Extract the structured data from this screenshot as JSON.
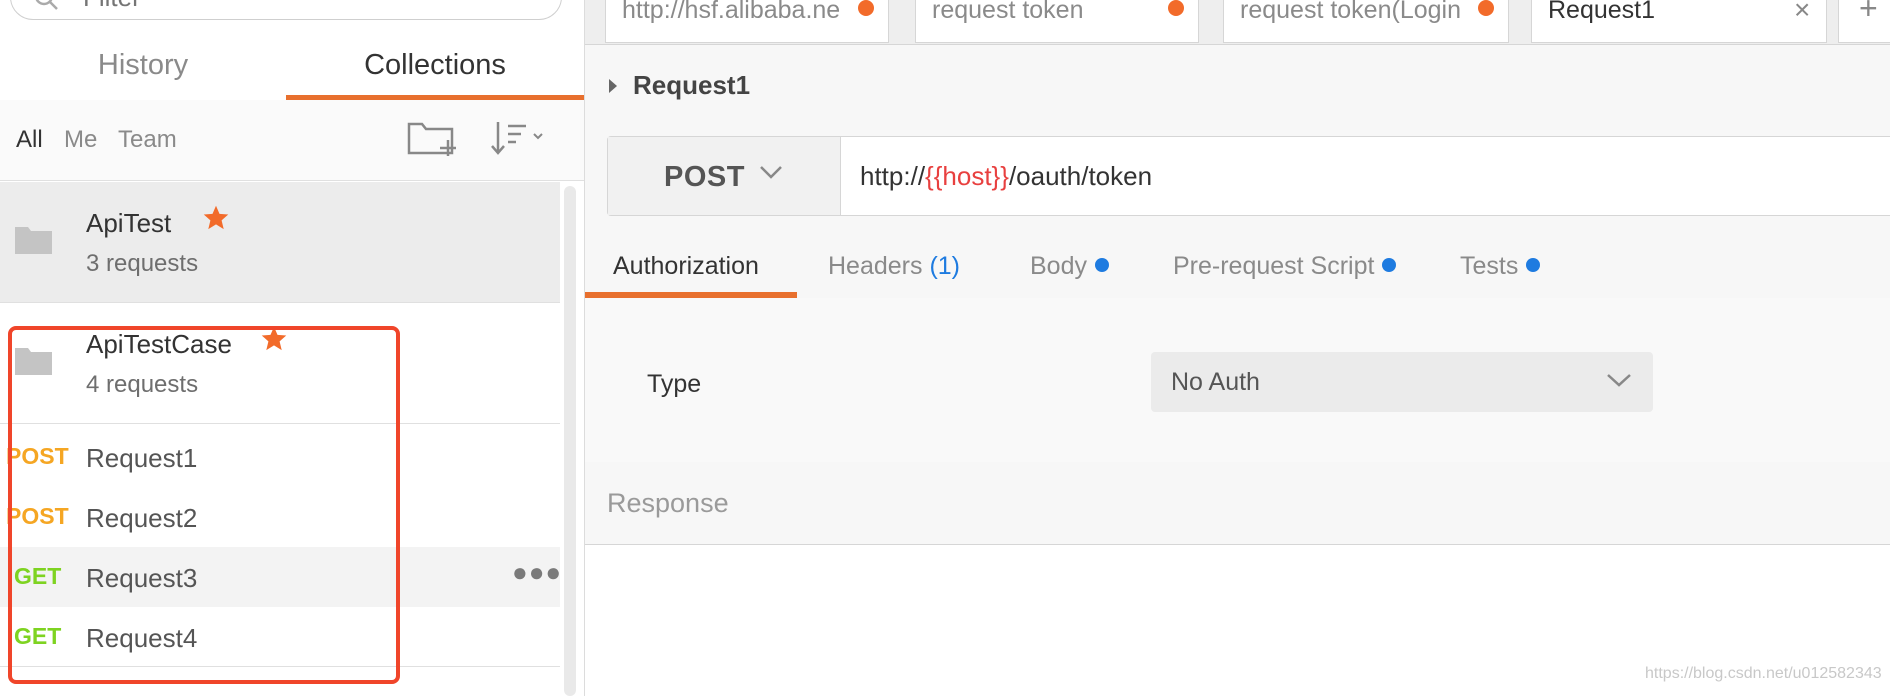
{
  "sidebar": {
    "filter_placeholder": "Filter",
    "tabs": {
      "history": "History",
      "collections": "Collections"
    },
    "filters": {
      "all": "All",
      "me": "Me",
      "team": "Team"
    },
    "collections": [
      {
        "name": "ApiTest",
        "count": "3 requests"
      },
      {
        "name": "ApiTestCase",
        "count": "4 requests"
      }
    ],
    "requests": [
      {
        "method": "POST",
        "name": "Request1"
      },
      {
        "method": "POST",
        "name": "Request2"
      },
      {
        "method": "GET",
        "name": "Request3"
      },
      {
        "method": "GET",
        "name": "Request4"
      }
    ]
  },
  "tabs": [
    {
      "label": "http://hsf.alibaba.ne"
    },
    {
      "label": "request token"
    },
    {
      "label": "request token(Login"
    },
    {
      "label": "Request1"
    }
  ],
  "request": {
    "title": "Request1",
    "method": "POST",
    "url_prefix": "http://",
    "url_var": "{{host}}",
    "url_suffix": "/oauth/token"
  },
  "sub_tabs": {
    "authorization": "Authorization",
    "headers": "Headers",
    "headers_count": "(1)",
    "body": "Body",
    "prerequest": "Pre-request Script",
    "tests": "Tests"
  },
  "auth": {
    "type_label": "Type",
    "value": "No Auth"
  },
  "response": {
    "label": "Response"
  },
  "watermark": "https://blog.csdn.net/u012582343",
  "colors": {
    "accent": "#e8702e",
    "post": "#f5a623",
    "get": "#7ed321",
    "dot": "#1e7be0",
    "highlight": "#f0452a",
    "var": "#e8403f"
  }
}
